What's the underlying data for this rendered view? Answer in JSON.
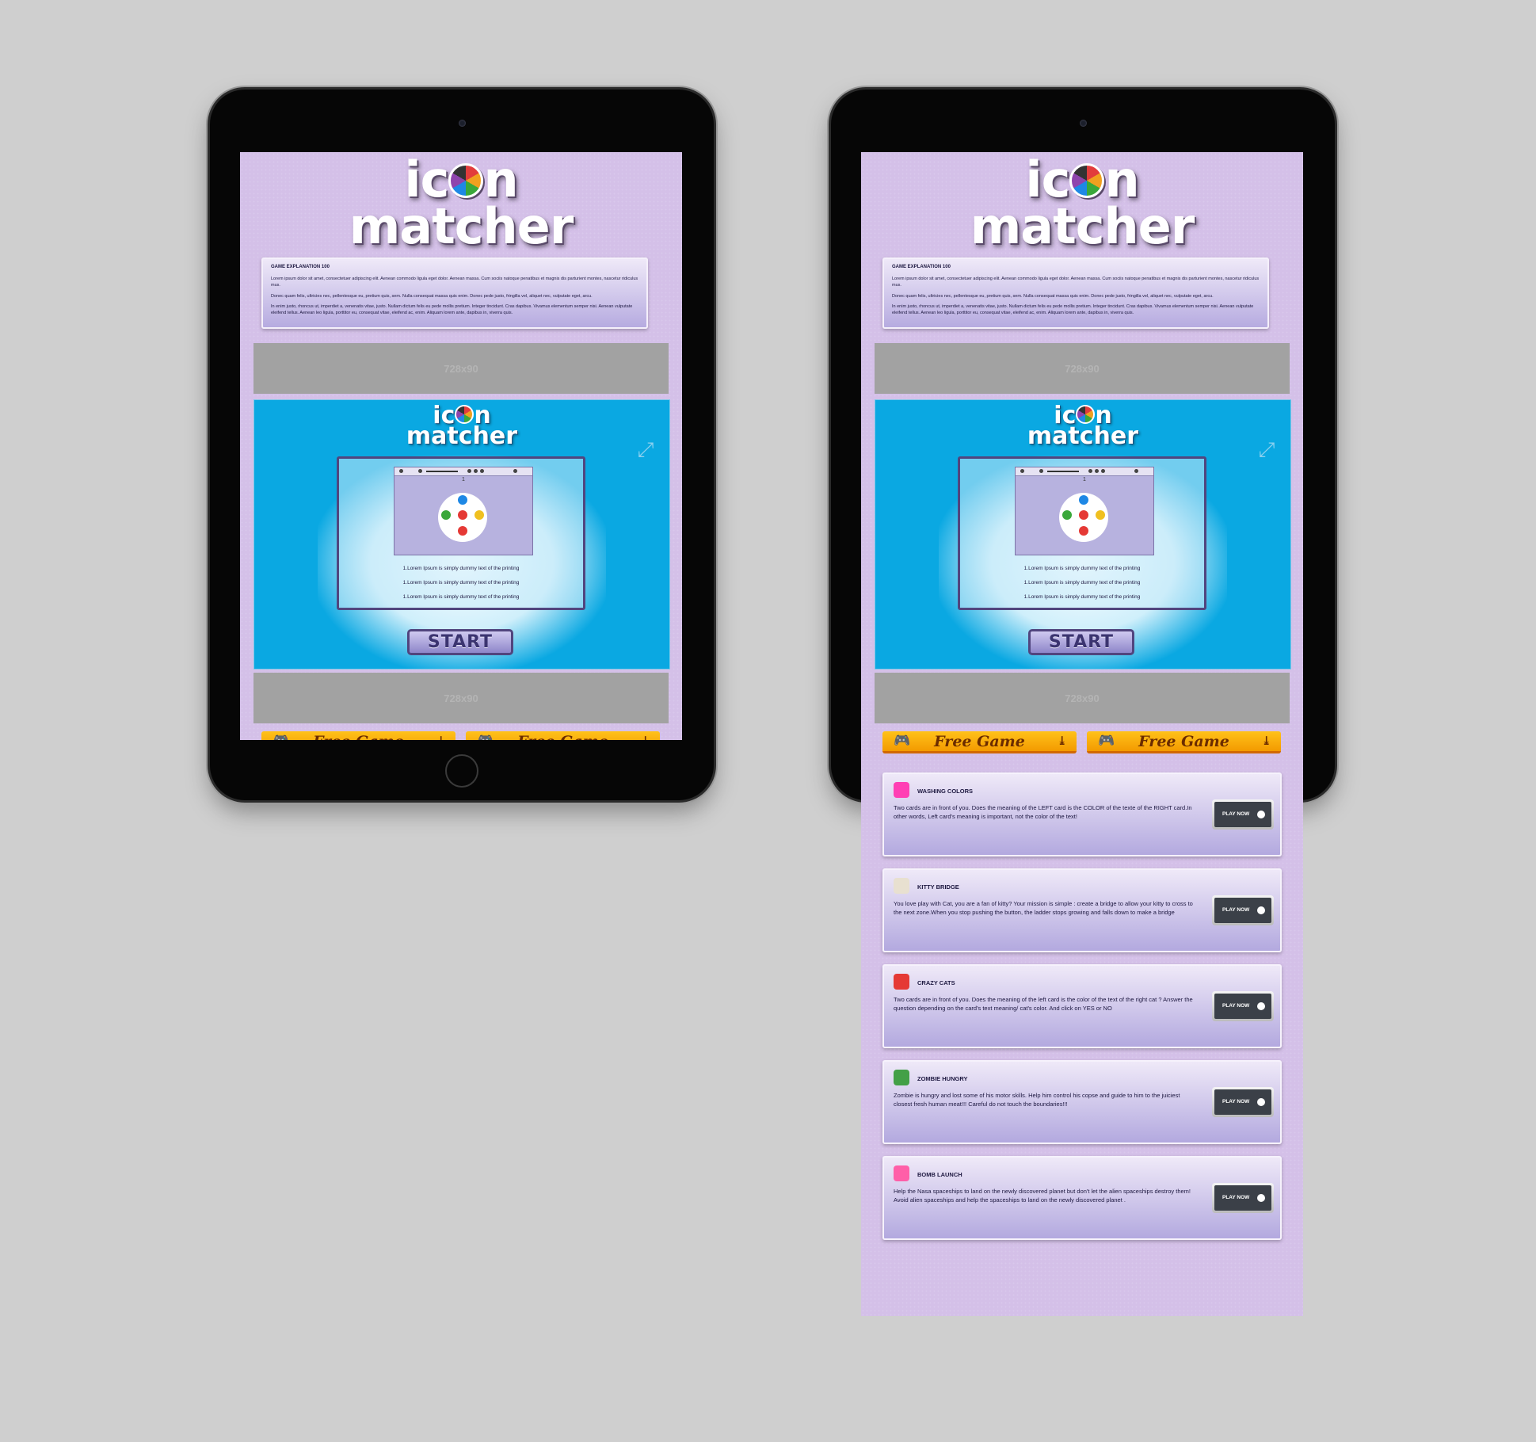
{
  "logo": {
    "line1_a": "ic",
    "line1_b": "n",
    "line2": "matcher"
  },
  "explanation": {
    "title": "GAME EXPLANATION 100",
    "paragraphs": [
      "Lorem ipsum dolor sit amet, consectetuer adipiscing elit. Aenean commodo ligula eget dolor. Aenean massa. Cum sociis natoque penatibus et magnis dis parturient montes, nascetur ridiculus mus.",
      "Donec quam felis, ultricies nec, pellentesque eu, pretium quis, sem. Nulla consequat massa quis enim. Donec pede justo, fringilla vel, aliquet nec, vulputate eget, arcu.",
      "In enim justo, rhoncus ut, imperdiet a, venenatis vitae, justo. Nullam dictum felis eu pede mollis pretium. Integer tincidunt. Cras dapibus. Vivamus elementum semper nisi. Aenean vulputate eleifend tellus. Aenean leo ligula, porttitor eu, consequat vitae, eleifend ac, enim. Aliquam lorem ante, dapibus in, viverra quis."
    ]
  },
  "ads": {
    "top": "728x90",
    "bottom": "728x90"
  },
  "game": {
    "logo_line1_a": "ic",
    "logo_line1_b": "n",
    "logo_line2": "matcher",
    "mini_counter": "1",
    "instructions": [
      "1.Lorem Ipsum is simply dummy text of the printing",
      "1.Lorem Ipsum is simply dummy text of the printing",
      "1.Lorem Ipsum is simply dummy text of the printing"
    ],
    "start_label": "START"
  },
  "free_buttons": [
    {
      "label": "Free Game"
    },
    {
      "label": "Free Game"
    }
  ],
  "games": [
    {
      "name": "WASHING COLORS",
      "icon": "washing-colors-icon",
      "color": "#ff3fb4",
      "desc": "Two cards are in front of you. Does the meaning of the LEFT card is the COLOR of the texte of the RIGHT card.In other words, Left card's meaning is important, not the color of the text!",
      "play": "PLAY NOW"
    },
    {
      "name": "KITTY BRIDGE",
      "icon": "kitty-bridge-icon",
      "color": "#e8e0d0",
      "desc": "You love play with Cat, you are a fan of kitty? Your mission is simple : create a bridge to allow your kitty to cross to the next zone.When you stop pushing the button, the ladder stops growing and falls down to make a bridge",
      "play": "PLAY NOW"
    },
    {
      "name": "CRAZY CATS",
      "icon": "crazy-cats-icon",
      "color": "#e53935",
      "desc": "Two cards are in front of you. Does the meaning of the left card is the color of the text of the right cat ? Answer the question depending on the card's text meaning/ cat's color. And click on YES or NO",
      "play": "PLAY NOW"
    },
    {
      "name": "ZOMBIE HUNGRY",
      "icon": "zombie-hungry-icon",
      "color": "#43a047",
      "desc": "Zombie is hungry and lost some of his motor skills. Help him control his copse and guide to him to the juiciest closest fresh human meat!!! Careful do not touch the boundaries!!!",
      "play": "PLAY NOW"
    },
    {
      "name": "BOMB LAUNCH",
      "icon": "bomb-launch-icon",
      "color": "#ff5fa8",
      "desc": "Help the Nasa spaceships to land on the newly discovered planet but don't let the alien spaceships destroy them! Avoid alien spaceships and help the spaceships to land on the newly discovered planet .",
      "play": "PLAY NOW"
    }
  ]
}
